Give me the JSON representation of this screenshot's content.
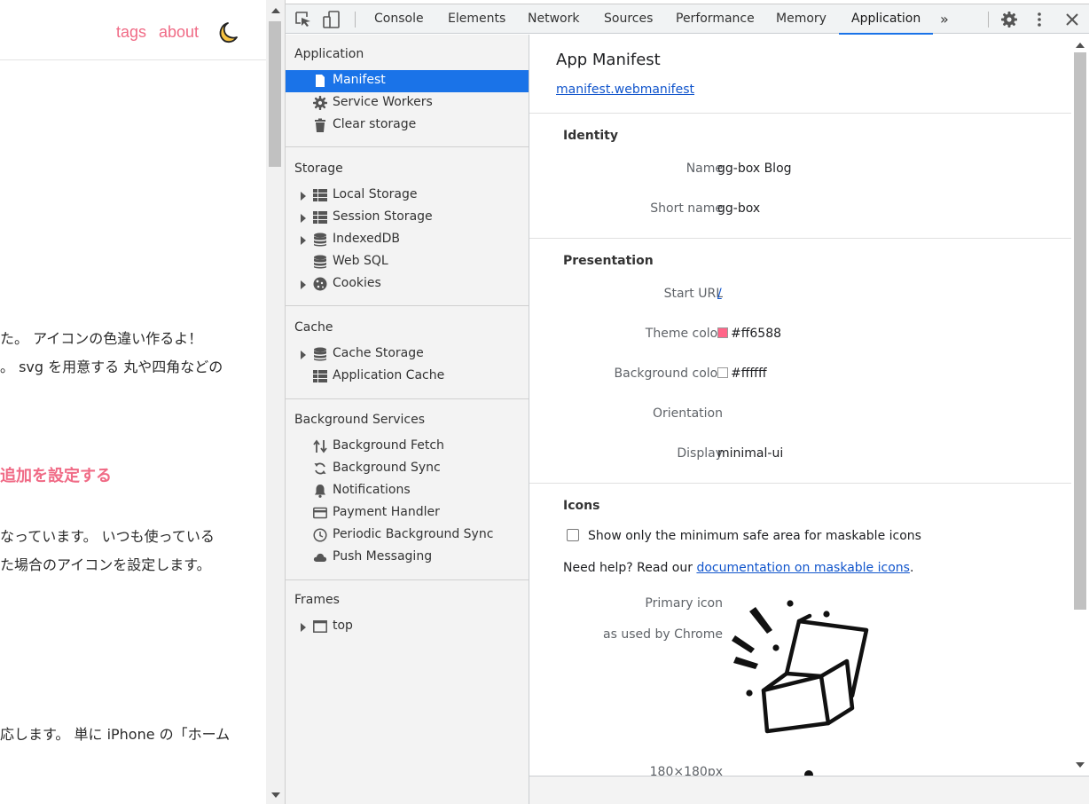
{
  "blog": {
    "nav": {
      "tags": "tags",
      "about": "about"
    },
    "moon_icon": "moon-icon",
    "lines": [
      "た。 アイコンの色違い作るよ！",
      "。 svg を用意する 丸や四角などの",
      "なっています。 いつも使っている",
      "た場合のアイコンを設定します。",
      "応します。 単に iPhone の「ホーム"
    ],
    "heading": "追加を設定する"
  },
  "devtools": {
    "tabs": [
      "Console",
      "Elements",
      "Network",
      "Sources",
      "Performance",
      "Memory",
      "Application"
    ],
    "active_tab": "Application",
    "more_tabs": "»",
    "sidebar": {
      "application": {
        "title": "Application",
        "items": [
          "Manifest",
          "Service Workers",
          "Clear storage"
        ]
      },
      "storage": {
        "title": "Storage",
        "items": [
          "Local Storage",
          "Session Storage",
          "IndexedDB",
          "Web SQL",
          "Cookies"
        ]
      },
      "cache": {
        "title": "Cache",
        "items": [
          "Cache Storage",
          "Application Cache"
        ]
      },
      "background_services": {
        "title": "Background Services",
        "items": [
          "Background Fetch",
          "Background Sync",
          "Notifications",
          "Payment Handler",
          "Periodic Background Sync",
          "Push Messaging"
        ]
      },
      "frames": {
        "title": "Frames",
        "items": [
          "top"
        ]
      }
    },
    "manifest": {
      "title": "App Manifest",
      "link": "manifest.webmanifest",
      "identity": {
        "title": "Identity",
        "name_label": "Name",
        "name": "gg-box Blog",
        "short_name_label": "Short name",
        "short_name": "gg-box"
      },
      "presentation": {
        "title": "Presentation",
        "start_url_label": "Start URL",
        "start_url": "/",
        "theme_color_label": "Theme color",
        "theme_color": "#ff6588",
        "background_color_label": "Background color",
        "background_color": "#ffffff",
        "orientation_label": "Orientation",
        "orientation": "",
        "display_label": "Display",
        "display": "minimal-ui"
      },
      "icons": {
        "title": "Icons",
        "maskable_checkbox": "Show only the minimum safe area for maskable icons",
        "maskable_checked": false,
        "help_prefix": "Need help? Read our ",
        "help_link": "documentation on maskable icons",
        "help_suffix": ".",
        "primary_label": "Primary icon",
        "primary_sublabel": "as used by Chrome",
        "size_label": "180×180px"
      }
    }
  },
  "colors": {
    "accent": "#1a73e8",
    "blog_pink": "#f06b86",
    "theme_swatch": "#ff6588"
  }
}
